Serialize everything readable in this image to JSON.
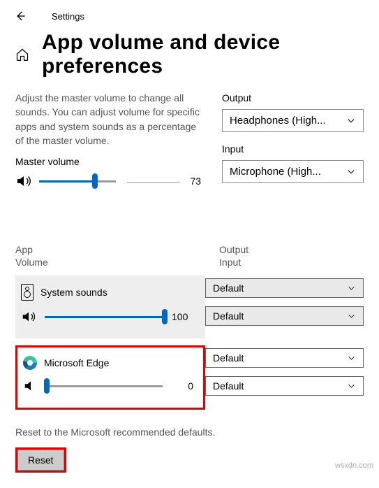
{
  "topbar": {
    "settings": "Settings"
  },
  "page_title": "App volume and device preferences",
  "description": "Adjust the master volume to change all sounds. You can adjust volume for specific apps and system sounds as a percentage of the master volume.",
  "master_volume": {
    "label": "Master volume",
    "value": "73"
  },
  "output": {
    "label": "Output",
    "value": "Headphones (High..."
  },
  "input": {
    "label": "Input",
    "value": "Microphone (High..."
  },
  "columns": {
    "app": "App",
    "volume": "Volume",
    "output": "Output",
    "input": "Input"
  },
  "apps": {
    "system": {
      "name": "System sounds",
      "value": "100",
      "output": "Default",
      "input": "Default"
    },
    "edge": {
      "name": "Microsoft Edge",
      "value": "0",
      "output": "Default",
      "input": "Default"
    }
  },
  "reset": {
    "description": "Reset to the Microsoft recommended defaults.",
    "button": "Reset"
  },
  "watermark": "wsxdn.com"
}
